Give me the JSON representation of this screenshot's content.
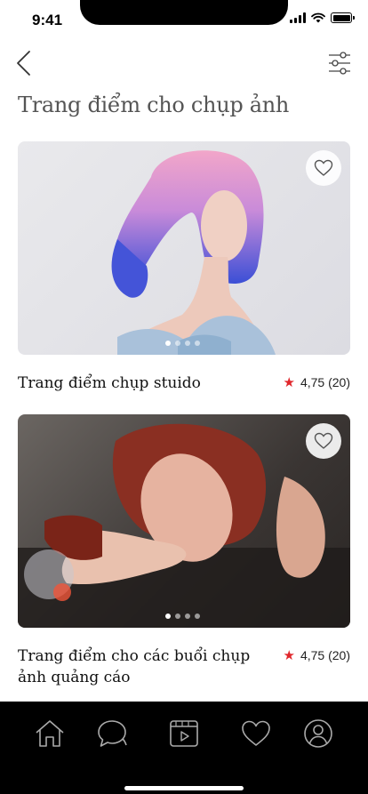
{
  "status": {
    "time": "9:41"
  },
  "header": {
    "title": "Trang điểm cho chụp ảnh"
  },
  "cards": [
    {
      "title": "Trang điểm chụp stuido",
      "rating": "4,75 (20)",
      "dots": 4,
      "active_dot": 0
    },
    {
      "title": "Trang điểm cho các buổi chụp ảnh quảng cáo",
      "rating": "4,75 (20)",
      "dots": 4,
      "active_dot": 0
    }
  ],
  "colors": {
    "accent_star": "#e0262b",
    "nav_background": "#000000",
    "title_text": "#555555"
  },
  "nav": {
    "items": [
      "home-icon",
      "chat-icon",
      "video-icon",
      "heart-icon",
      "profile-icon"
    ]
  }
}
